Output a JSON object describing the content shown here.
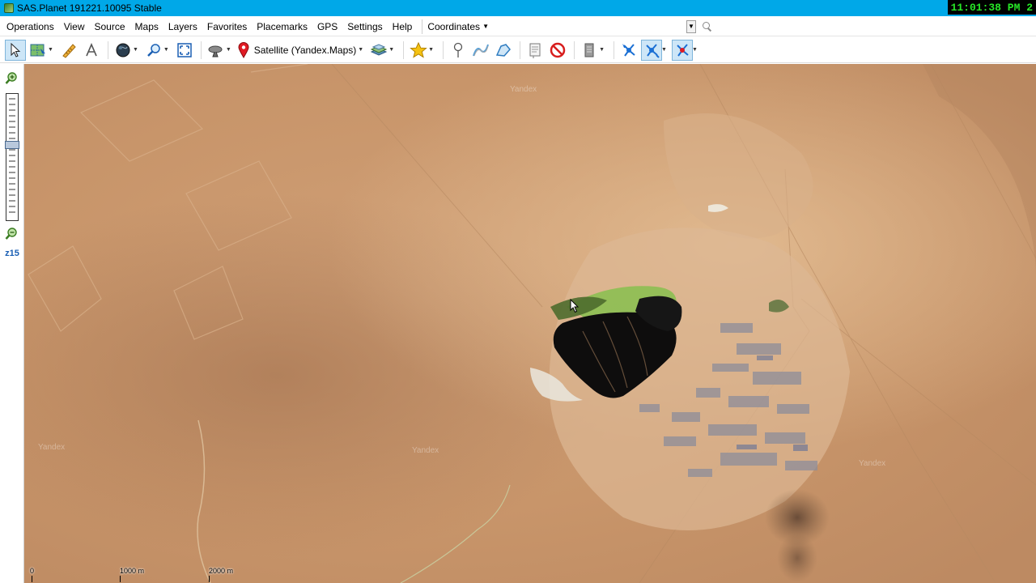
{
  "window": {
    "title": "SAS.Planet 191221.10095 Stable",
    "clock": "11:01:38 PM 2"
  },
  "menu": {
    "items": [
      "Operations",
      "View",
      "Source",
      "Maps",
      "Layers",
      "Favorites",
      "Placemarks",
      "GPS",
      "Settings",
      "Help"
    ],
    "coordinates_label": "Coordinates",
    "coordinates_value": ""
  },
  "toolbar": {
    "map_source_label": "Satellite (Yandex.Maps)",
    "buttons": [
      {
        "name": "select-tool",
        "icon": "cursor-arrow-icon",
        "active": true
      },
      {
        "name": "map-move-tool",
        "icon": "map-move-icon"
      },
      {
        "name": "ruler-tool",
        "icon": "ruler-icon"
      },
      {
        "name": "text-tool",
        "icon": "text-a-icon"
      },
      {
        "name": "globe-tool",
        "icon": "globe-icon"
      },
      {
        "name": "zoom-tool",
        "icon": "magnifier-icon"
      },
      {
        "name": "fullscreen-tool",
        "icon": "fullscreen-icon"
      },
      {
        "name": "satellite-dish-tool",
        "icon": "satellite-dish-icon"
      },
      {
        "name": "placemark-source",
        "icon": "red-pin-icon"
      },
      {
        "name": "layers-tool",
        "icon": "layers-stack-icon"
      },
      {
        "name": "favorites-tool",
        "icon": "star-icon"
      },
      {
        "name": "add-point-tool",
        "icon": "pushpin-icon"
      },
      {
        "name": "add-path-tool",
        "icon": "path-icon"
      },
      {
        "name": "add-polygon-tool",
        "icon": "polygon-icon"
      },
      {
        "name": "placemark-manager-tool",
        "icon": "placemark-list-icon"
      },
      {
        "name": "stop-tool",
        "icon": "stop-circle-icon"
      },
      {
        "name": "gps-panel-tool",
        "icon": "gps-panel-icon"
      },
      {
        "name": "gps-connect-tool",
        "icon": "gps-satellite-icon"
      },
      {
        "name": "gps-track-tool",
        "icon": "gps-satellite-icon",
        "active": true
      },
      {
        "name": "gps-center-tool",
        "icon": "gps-satellite-icon",
        "active": true
      }
    ]
  },
  "zoom": {
    "level_label": "z15",
    "level_fraction": 0.4
  },
  "map": {
    "watermark": "Yandex",
    "scale_labels": [
      "0",
      "1000 m",
      "2000 m"
    ]
  }
}
